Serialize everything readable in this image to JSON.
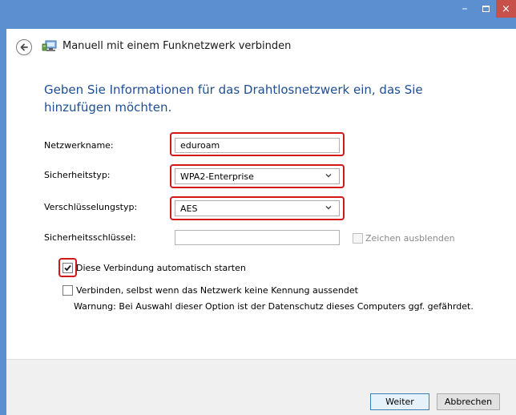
{
  "window": {
    "title": "Manuell mit einem Funknetzwerk verbinden",
    "controls": {
      "minimize": "–",
      "close": "×"
    },
    "accent_color": "#5b8fd0",
    "close_color": "#c7504a"
  },
  "heading": "Geben Sie Informationen für das Drahtlosnetzwerk ein, das Sie hinzufügen möchten.",
  "form": {
    "network_name": {
      "label": "Netzwerkname:",
      "value": "eduroam"
    },
    "security_type": {
      "label": "Sicherheitstyp:",
      "value": "WPA2-Enterprise"
    },
    "encryption_type": {
      "label": "Verschlüsselungstyp:",
      "value": "AES"
    },
    "security_key": {
      "label": "Sicherheitsschlüssel:",
      "value": ""
    },
    "hide_chars": {
      "label": "Zeichen ausblenden",
      "checked": false,
      "enabled": false
    },
    "auto_start": {
      "label": "Diese Verbindung automatisch starten",
      "checked": true
    },
    "connect_hidden": {
      "label": "Verbinden, selbst wenn das Netzwerk keine Kennung aussendet",
      "checked": false
    },
    "warning": "Warnung: Bei Auswahl dieser Option ist der Datenschutz dieses Computers ggf. gefährdet."
  },
  "buttons": {
    "next": "Weiter",
    "cancel": "Abbrechen"
  },
  "highlight_color": "#d01818",
  "icons": {
    "back": "back-arrow-icon",
    "network": "wireless-network-icon",
    "dropdown": "chevron-down-icon"
  }
}
